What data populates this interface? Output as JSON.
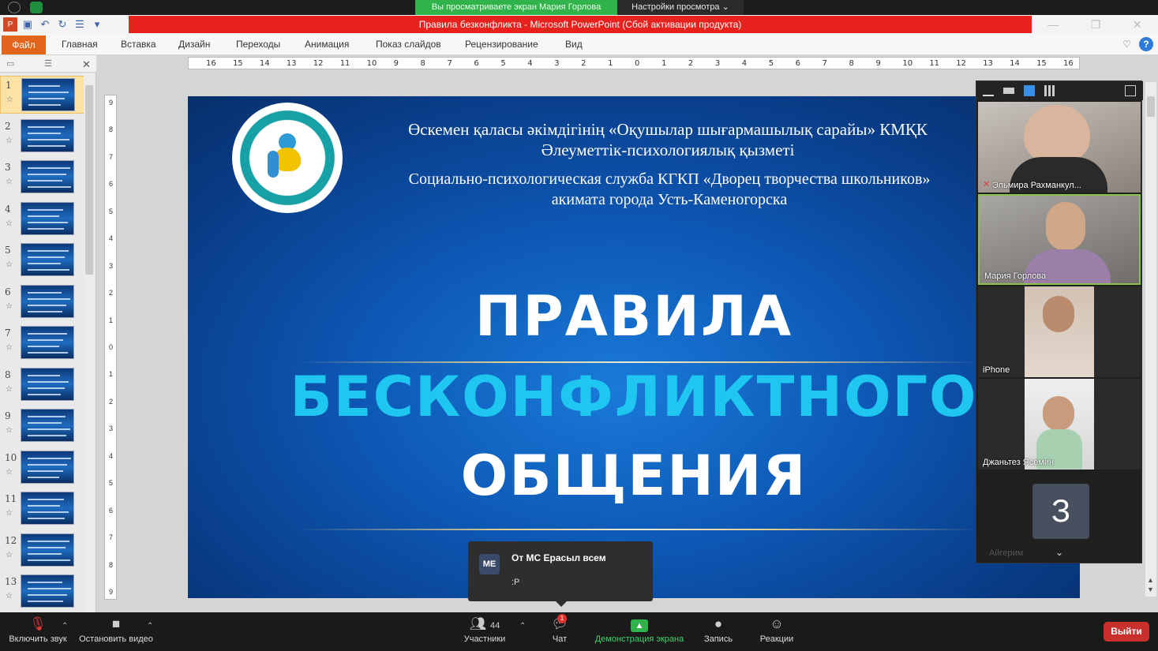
{
  "zoom_top": {
    "share_banner": "Вы просматриваете экран Мария Горлова",
    "view_options": "Настройки просмотра"
  },
  "window": {
    "title": "Правила безконфликта  -  Microsoft PowerPoint (Сбой активации продукта)"
  },
  "ribbon": {
    "file": "Файл",
    "tabs": [
      "Главная",
      "Вставка",
      "Дизайн",
      "Переходы",
      "Анимация",
      "Показ слайдов",
      "Рецензирование",
      "Вид"
    ]
  },
  "ruler": {
    "h_ticks": [
      "16",
      "15",
      "14",
      "13",
      "12",
      "11",
      "10",
      "9",
      "8",
      "7",
      "6",
      "5",
      "4",
      "3",
      "2",
      "1",
      "0",
      "1",
      "2",
      "3",
      "4",
      "5",
      "6",
      "7",
      "8",
      "9",
      "10",
      "11",
      "12",
      "13",
      "14",
      "15",
      "16"
    ],
    "v_ticks": [
      "9",
      "8",
      "7",
      "6",
      "5",
      "4",
      "3",
      "2",
      "1",
      "0",
      "1",
      "2",
      "3",
      "4",
      "5",
      "6",
      "7",
      "8",
      "9"
    ]
  },
  "thumbnails": [
    "1",
    "2",
    "3",
    "4",
    "5",
    "6",
    "7",
    "8",
    "9",
    "10",
    "11",
    "12",
    "13"
  ],
  "slide": {
    "org_kz_line1": "Өскемен қаласы әкімдігінің «Оқушылар шығармашылық сарайы» КМҚК",
    "org_kz_line2": "Әлеуметтік-психологиялық қызметі",
    "org_ru_line1": "Социально-психологическая служба КГКП «Дворец творчества школьников»",
    "org_ru_line2": "акимата города Усть-Каменогорска",
    "title_line1": "ПРАВИЛА",
    "title_line2": "БЕСКОНФЛИКТНОГО",
    "title_line3": "ОБЩЕНИЯ"
  },
  "chat_popup": {
    "avatar": "МЕ",
    "from": "От МС Ерасыл всем",
    "message": ":P"
  },
  "gallery": {
    "tiles": [
      {
        "name": "Эльмира Рахманкул..."
      },
      {
        "name": "Мария Горлова"
      },
      {
        "name": "iPhone"
      },
      {
        "name": "Джаньтез Ясемин"
      },
      {
        "name": "Айгерим",
        "initial": "З"
      }
    ]
  },
  "bottom_bar": {
    "mute": "Включить звук",
    "video": "Остановить видео",
    "participants_count": "44",
    "participants": "Участники",
    "chat": "Чат",
    "chat_badge": "1",
    "share": "Демонстрация экрана",
    "record": "Запись",
    "reactions": "Реакции",
    "leave": "Выйти"
  }
}
